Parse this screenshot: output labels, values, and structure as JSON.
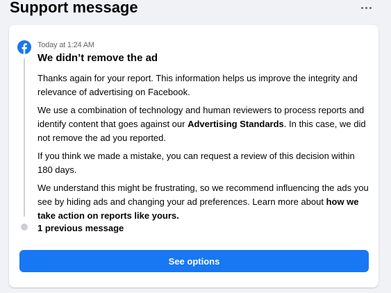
{
  "header": {
    "title": "Support message",
    "more_icon": "more-horizontal-icon"
  },
  "message": {
    "sender_icon": "facebook-logo-icon",
    "timestamp": "Today at 1:24 AM",
    "title": "We didn’t remove the ad",
    "paragraph1": "Thanks again for your report. This information helps us improve the integrity and relevance of advertising on Facebook.",
    "paragraph2_before": "We use a combination of technology and human reviewers to process reports and identify content that goes against our ",
    "paragraph2_bold": "Advertising Standards",
    "paragraph2_after": ". In this case, we did not remove the ad you reported.",
    "paragraph3": "If you think we made a mistake, you can request a review of this decision within 180 days.",
    "paragraph4_before": "We understand this might be frustrating, so we recommend influencing the ads you see by hiding ads and changing your ad preferences. Learn more about ",
    "paragraph4_link": "how we take action on reports like yours."
  },
  "previous_messages_label": "1 previous message",
  "actions": {
    "see_options_label": "See options"
  },
  "colors": {
    "primary_button": "#1877f2",
    "facebook_blue": "#1877f2",
    "background": "#f0f2f5",
    "timeline": "#ccd0d5"
  }
}
